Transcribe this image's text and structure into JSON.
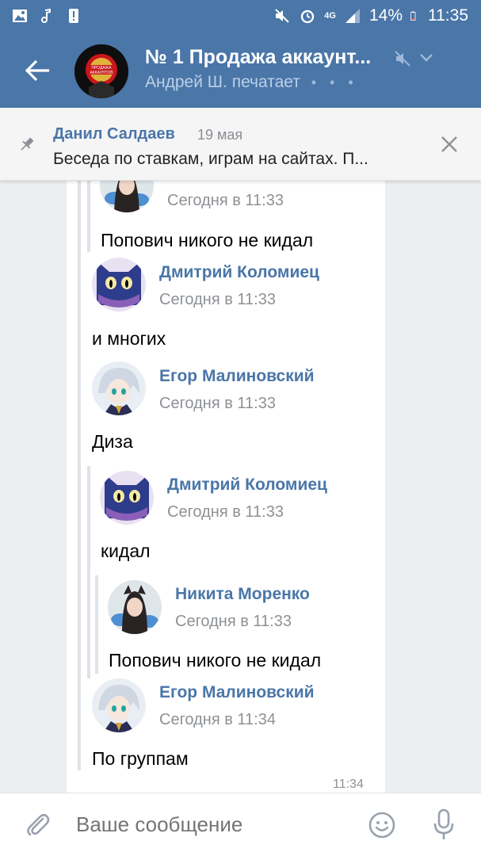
{
  "status_bar": {
    "network": "4G",
    "battery": "14%",
    "time": "11:35"
  },
  "header": {
    "title": "№ 1 Продажа аккаунт...",
    "subtitle": "Андрей Ш. печатает",
    "typing_dots": "• • •",
    "avatar_text_top": "ПРОДАЖА",
    "avatar_text_mid": "АККАУНТОВ"
  },
  "pinned": {
    "author": "Данил Салдаев",
    "date": "19 мая",
    "text": "Беседа по ставкам, играм на сайтах. П..."
  },
  "messages": [
    {
      "author": "",
      "time": "Сегодня в 11:33",
      "text": "Попович никого не кидал",
      "avatar": "girl-avatar"
    },
    {
      "author": "Дмитрий Коломиец",
      "time": "Сегодня в 11:33",
      "text": "и многих",
      "avatar": "cat-avatar"
    },
    {
      "author": "Егор Малиновский",
      "time": "Сегодня в 11:33",
      "text": "Диза",
      "avatar": "anime-avatar"
    },
    {
      "author": "Дмитрий Коломиец",
      "time": "Сегодня в 11:33",
      "text": "кидал",
      "avatar": "cat-avatar"
    },
    {
      "author": "Никита Моренко",
      "time": "Сегодня в 11:33",
      "text": "Попович никого не кидал",
      "avatar": "girl-avatar"
    },
    {
      "author": "Егор Малиновский",
      "time": "Сегодня в 11:34",
      "text": "По группам",
      "avatar": "anime-avatar"
    }
  ],
  "message_time": "11:34",
  "composer": {
    "placeholder": "Ваше сообщение"
  },
  "colors": {
    "brand": "#4a76a8",
    "link": "#4a76a8",
    "background": "#edeef0"
  }
}
